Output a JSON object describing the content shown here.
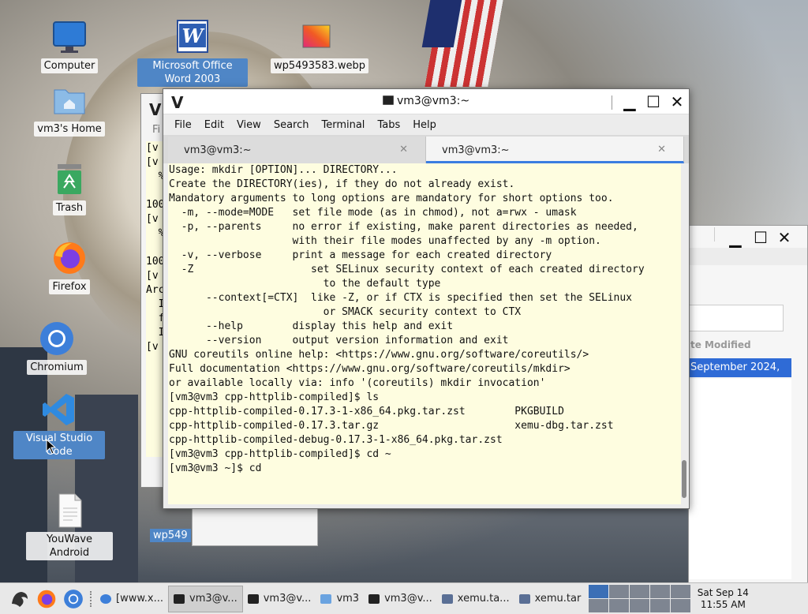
{
  "desktop": {
    "icons": [
      {
        "label": "Computer"
      },
      {
        "label": "Microsoft Office Word 2003"
      },
      {
        "label": "wp5493583.webp"
      },
      {
        "label": "vm3's Home"
      },
      {
        "label": "Trash"
      },
      {
        "label": "Firefox"
      },
      {
        "label": "Chromium"
      },
      {
        "label": "Visual Studio Code"
      },
      {
        "label": "YouWave Android"
      }
    ]
  },
  "bg_terminal": {
    "title_letter": "V",
    "menu_fragment": "Fi",
    "lines": [
      "[v",
      "[v",
      "  %",
      "",
      "100",
      "[v",
      "  %",
      "",
      "100",
      "[v",
      "Arc",
      "  I",
      "  f",
      "  I",
      "[v"
    ]
  },
  "bg_fm": {
    "column_header": "te Modified",
    "selected_row": "September 2024, ..."
  },
  "bg_taskicon_label": "wp549",
  "terminal": {
    "app_logo": "V",
    "title": "vm3@vm3:~",
    "menu": [
      "File",
      "Edit",
      "View",
      "Search",
      "Terminal",
      "Tabs",
      "Help"
    ],
    "tabs": [
      {
        "label": "vm3@vm3:~",
        "active": false
      },
      {
        "label": "vm3@vm3:~",
        "active": true
      }
    ],
    "lines": [
      "Usage: mkdir [OPTION]... DIRECTORY...",
      "Create the DIRECTORY(ies), if they do not already exist.",
      "",
      "Mandatory arguments to long options are mandatory for short options too.",
      "  -m, --mode=MODE   set file mode (as in chmod), not a=rwx - umask",
      "  -p, --parents     no error if existing, make parent directories as needed,",
      "                    with their file modes unaffected by any -m option.",
      "  -v, --verbose     print a message for each created directory",
      "  -Z                   set SELinux security context of each created directory",
      "                         to the default type",
      "      --context[=CTX]  like -Z, or if CTX is specified then set the SELinux",
      "                         or SMACK security context to CTX",
      "      --help        display this help and exit",
      "      --version     output version information and exit",
      "",
      "GNU coreutils online help: <https://www.gnu.org/software/coreutils/>",
      "Full documentation <https://www.gnu.org/software/coreutils/mkdir>",
      "or available locally via: info '(coreutils) mkdir invocation'",
      "[vm3@vm3 cpp-httplib-compiled]$ ls",
      "cpp-httplib-compiled-0.17.3-1-x86_64.pkg.tar.zst        PKGBUILD",
      "cpp-httplib-compiled-0.17.3.tar.gz                      xemu-dbg.tar.zst",
      "cpp-httplib-compiled-debug-0.17.3-1-x86_64.pkg.tar.zst",
      "[vm3@vm3 cpp-httplib-compiled]$ cd ~",
      "[vm3@vm3 ~]$ cd"
    ]
  },
  "taskbar": {
    "tasks": [
      {
        "label": "[www.x...",
        "icon": "chromium-icon",
        "active": false
      },
      {
        "label": "vm3@v...",
        "icon": "terminal-icon",
        "active": true
      },
      {
        "label": "vm3@v...",
        "icon": "terminal-icon",
        "active": false
      },
      {
        "label": "vm3",
        "icon": "folder-icon",
        "active": false
      },
      {
        "label": "vm3@v...",
        "icon": "terminal-icon",
        "active": false
      },
      {
        "label": "xemu.ta...",
        "icon": "archive-icon",
        "active": false
      },
      {
        "label": "xemu.tar",
        "icon": "archive-icon",
        "active": false
      }
    ],
    "clock_date": "Sat Sep 14",
    "clock_time": "11:55 AM"
  },
  "colors": {
    "terminal_bg": "#fefde0",
    "tab_accent": "#3b7de0",
    "selection": "#4f86c6"
  }
}
